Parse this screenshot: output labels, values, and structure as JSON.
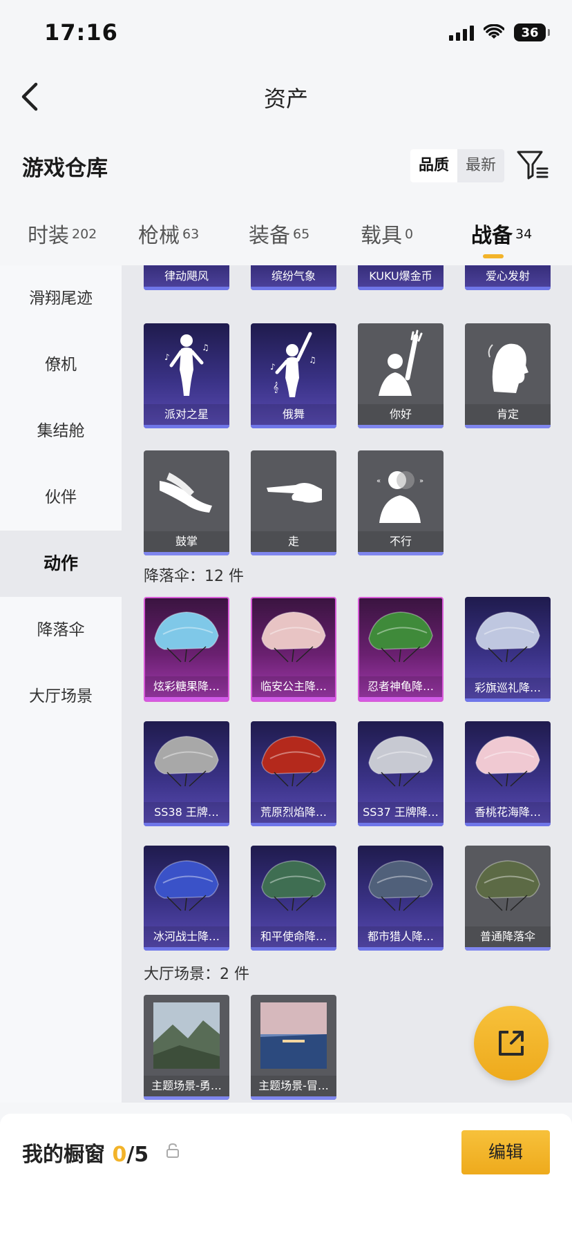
{
  "status_bar": {
    "time": "17:16",
    "battery": "36"
  },
  "nav": {
    "title": "资产"
  },
  "header": {
    "title": "游戏仓库",
    "sort_options": [
      {
        "label": "品质",
        "active": true
      },
      {
        "label": "最新",
        "active": false
      }
    ]
  },
  "tabs": [
    {
      "label": "时装",
      "count": "202"
    },
    {
      "label": "枪械",
      "count": "63"
    },
    {
      "label": "装备",
      "count": "65"
    },
    {
      "label": "载具",
      "count": "0"
    },
    {
      "label": "战备",
      "count": "34",
      "active": true
    }
  ],
  "sidebar": {
    "items": [
      {
        "label": "滑翔尾迹"
      },
      {
        "label": "僚机"
      },
      {
        "label": "集结舱"
      },
      {
        "label": "伙伴"
      },
      {
        "label": "动作",
        "active": true
      },
      {
        "label": "降落伞"
      },
      {
        "label": "大厅场景"
      }
    ]
  },
  "content": {
    "top_partial_row": [
      "律动飓风",
      "缤纷气象",
      "KUKU爆金币",
      "爱心发射"
    ],
    "actions_row1": [
      {
        "label": "派对之星",
        "style": "purple",
        "icon": "dancer-figure-icon"
      },
      {
        "label": "俄舞",
        "style": "purple",
        "icon": "dancer-arm-up-icon"
      },
      {
        "label": "你好",
        "style": "grey",
        "icon": "wave-hello-icon"
      },
      {
        "label": "肯定",
        "style": "grey",
        "icon": "head-nod-icon"
      }
    ],
    "actions_row2": [
      {
        "label": "鼓掌",
        "style": "grey",
        "icon": "clap-hands-icon"
      },
      {
        "label": "走",
        "style": "grey",
        "icon": "point-hand-icon"
      },
      {
        "label": "不行",
        "style": "grey",
        "icon": "head-shake-icon"
      }
    ],
    "parachute_section": "降落伞：12 件",
    "parachutes": [
      {
        "label": "炫彩糖果降…",
        "style": "pink",
        "color": "#7fc8e8"
      },
      {
        "label": "临安公主降…",
        "style": "pink",
        "color": "#e8c4c4"
      },
      {
        "label": "忍者神龟降…",
        "style": "pink",
        "color": "#3f8a3a"
      },
      {
        "label": "彩旗巡礼降…",
        "style": "purple",
        "color": "#bfc7e0"
      },
      {
        "label": "SS38 王牌…",
        "style": "purple",
        "color": "#a8a8a8"
      },
      {
        "label": "荒原烈焰降…",
        "style": "purple",
        "color": "#b4291c"
      },
      {
        "label": "SS37 王牌降…",
        "style": "purple",
        "color": "#c7c9d2"
      },
      {
        "label": "香桃花海降…",
        "style": "purple",
        "color": "#f0c9d2"
      },
      {
        "label": "冰河战士降…",
        "style": "purple",
        "color": "#3a52c8"
      },
      {
        "label": "和平使命降…",
        "style": "purple",
        "color": "#3f6e52"
      },
      {
        "label": "都市猎人降…",
        "style": "purple",
        "color": "#50607a"
      },
      {
        "label": "普通降落伞",
        "style": "grey",
        "color": "#5c6a45"
      }
    ],
    "lobby_section": "大厅场景：2 件",
    "lobby_scenes": [
      {
        "label": "主题场景-勇…",
        "style": "grey"
      },
      {
        "label": "主题场景-冒…",
        "style": "grey"
      }
    ]
  },
  "bottom_bar": {
    "label": "我的橱窗",
    "current": "0",
    "total": "/5",
    "edit_label": "编辑"
  },
  "colors": {
    "accent": "#f2b32a",
    "card_purple": "#3a3286",
    "card_pink": "#a33bb0",
    "card_grey": "#58595e"
  }
}
